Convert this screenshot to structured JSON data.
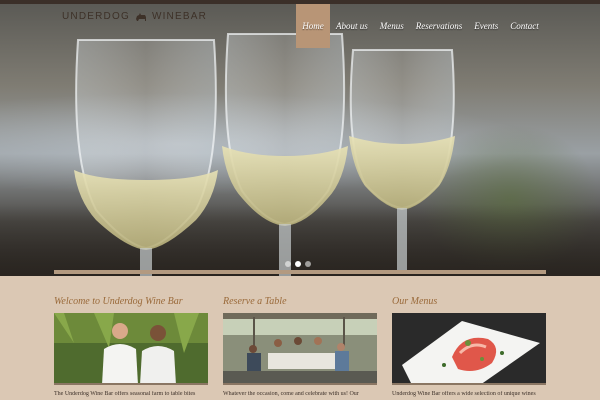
{
  "site": {
    "logo_text_main": "UNDERDOG",
    "logo_text_bar": "WINEBAR",
    "logo_icon": "dog-icon"
  },
  "nav": {
    "items": [
      "Home",
      "About us",
      "Menus",
      "Reservations",
      "Events",
      "Contact"
    ],
    "active": "Home",
    "accent_color": "#b89576"
  },
  "hero": {
    "slide_count": 3,
    "active_slide": 1
  },
  "sections": [
    {
      "title": "Welcome to Underdog Wine Bar",
      "image": "chefs-photo",
      "text": "The Underdog Wine Bar offers seasonal farm to table bites"
    },
    {
      "title": "Reserve a Table",
      "image": "patio-dining-photo",
      "text": "Whatever the occasion, come and celebrate with us! Our"
    },
    {
      "title": "Our Menus",
      "image": "plated-dish-photo",
      "text": "Underdog Wine Bar offers a wide selection of unique wines"
    }
  ],
  "colors": {
    "background": "#dbc8b4",
    "heading": "#9a6a3a",
    "text": "#3b2f28"
  }
}
